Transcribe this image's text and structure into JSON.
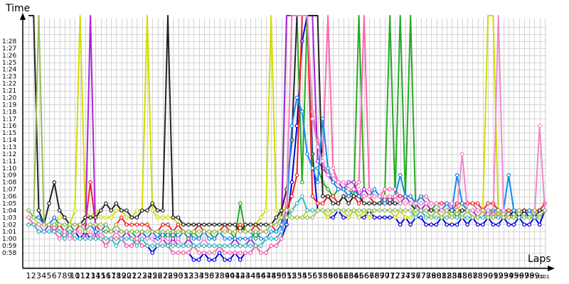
{
  "chart_data": {
    "type": "line",
    "title": "",
    "xlabel": "Laps",
    "ylabel": "Time",
    "x_range": [
      1,
      101
    ],
    "ylim_seconds": [
      56,
      90
    ],
    "grid": true,
    "legend": "none",
    "x_tick_labels": [
      "1",
      "2",
      "3",
      "4",
      "5",
      "6",
      "7",
      "8",
      "9",
      "10",
      "11",
      "12",
      "13",
      "14",
      "15",
      "16",
      "17",
      "18",
      "19",
      "20",
      "21",
      "22",
      "23",
      "24",
      "25",
      "26",
      "27",
      "28",
      "29",
      "30",
      "31",
      "32",
      "33",
      "34",
      "35",
      "36",
      "37",
      "38",
      "39",
      "40",
      "41",
      "42",
      "43",
      "44",
      "45",
      "46",
      "47",
      "48",
      "49",
      "50",
      "51",
      "52",
      "53",
      "54",
      "55",
      "56",
      "57",
      "58",
      "59",
      "60",
      "61",
      "62",
      "63",
      "64",
      "65",
      "66",
      "67",
      "68",
      "69",
      "70",
      "71",
      "72",
      "73",
      "74",
      "75",
      "76",
      "77",
      "78",
      "79",
      "80",
      "81",
      "82",
      "83",
      "84",
      "85",
      "86",
      "87",
      "88",
      "89",
      "90",
      "91",
      "92",
      "93",
      "94",
      "95",
      "96",
      "97",
      "98",
      "99",
      "100",
      "101"
    ],
    "y_tick_labels": [
      "0:58",
      "0:59",
      "1:00",
      "1:01",
      "1:02",
      "1:03",
      "1:04",
      "1:05",
      "1:06",
      "1:07",
      "1:08",
      "1:09",
      "1:10",
      "1:11",
      "1:12",
      "1:13",
      "1:14",
      "1:15",
      "1:16",
      "1:17",
      "1:18",
      "1:19",
      "1:20",
      "1:21",
      "1:22",
      "1:23",
      "1:24",
      "1:25",
      "1:26",
      "1:27",
      "1:28"
    ],
    "series": [
      {
        "color": "#0000dd",
        "y": [
          63,
          62,
          62,
          61,
          61,
          62,
          61,
          60,
          61,
          61,
          60,
          61,
          60,
          60,
          60,
          59,
          60,
          60,
          60,
          59,
          59,
          60,
          59,
          59,
          58,
          59,
          59,
          59,
          58,
          58,
          58,
          58,
          57,
          57,
          58,
          57,
          57,
          58,
          57,
          57,
          58,
          57,
          58,
          58,
          59,
          58,
          58,
          59,
          59,
          60,
          62,
          68,
          76,
          88,
          92,
          72,
          64,
          64,
          63,
          63,
          64,
          63,
          63,
          64,
          63,
          63,
          64,
          63,
          63,
          63,
          63,
          63,
          62,
          63,
          62,
          63,
          63,
          62,
          62,
          62,
          63,
          62,
          62,
          62,
          63,
          62,
          63,
          62,
          62,
          63,
          62,
          62,
          63,
          62,
          62,
          63,
          62,
          62,
          63,
          62,
          64
        ]
      },
      {
        "color": "#d0dd00",
        "y": [
          63,
          63,
          62,
          62,
          62,
          62,
          63,
          63,
          62,
          64,
          95,
          64,
          63,
          64,
          63,
          63,
          63,
          64,
          64,
          63,
          63,
          64,
          64,
          95,
          64,
          63,
          63,
          63,
          63,
          62,
          62,
          62,
          62,
          62,
          62,
          62,
          62,
          62,
          62,
          62,
          62,
          62,
          62,
          62,
          62,
          63,
          64,
          95,
          64,
          63,
          65,
          63,
          63,
          63,
          64,
          64,
          64,
          64,
          63,
          64,
          64,
          64,
          63,
          64,
          63,
          64,
          63,
          64,
          64,
          64,
          64,
          63,
          64,
          63,
          63,
          64,
          64,
          64,
          63,
          64,
          63,
          63,
          64,
          64,
          65,
          64,
          64,
          63,
          64,
          95,
          95,
          63,
          64,
          64,
          63,
          63,
          63,
          63,
          63,
          63,
          64
        ]
      },
      {
        "color": "#22aa22",
        "y": [
          64,
          63,
          63,
          62,
          62,
          62,
          62,
          61,
          62,
          61,
          62,
          61,
          62,
          61,
          61,
          61,
          61,
          61,
          61,
          61,
          61,
          60,
          61,
          60,
          61,
          61,
          60,
          61,
          60,
          61,
          61,
          60,
          61,
          60,
          61,
          61,
          60,
          61,
          61,
          61,
          60,
          65,
          61,
          61,
          60,
          61,
          61,
          62,
          62,
          63,
          95,
          95,
          95,
          68,
          95,
          70,
          70,
          68,
          67,
          66,
          67,
          67,
          67,
          66,
          95,
          67,
          66,
          65,
          65,
          66,
          95,
          66,
          95,
          66,
          95,
          64,
          64,
          64,
          64,
          65,
          64,
          64,
          64,
          63,
          64,
          64,
          63,
          63,
          64,
          63,
          64,
          63,
          63,
          64,
          63,
          63,
          64,
          63,
          63,
          64,
          64
        ]
      },
      {
        "color": "#ff66aa",
        "y": [
          62,
          62,
          61,
          61,
          61,
          61,
          60,
          61,
          60,
          60,
          60,
          60,
          60,
          61,
          60,
          59,
          60,
          60,
          60,
          59,
          59,
          60,
          59,
          59,
          59,
          59,
          59,
          59,
          58,
          58,
          58,
          58,
          59,
          58,
          58,
          58,
          58,
          59,
          58,
          58,
          58,
          58,
          58,
          58,
          59,
          58,
          58,
          59,
          59,
          60,
          65,
          95,
          95,
          95,
          95,
          78,
          74,
          72,
          95,
          70,
          68,
          68,
          67,
          67,
          68,
          95,
          67,
          66,
          66,
          67,
          67,
          67,
          66,
          66,
          66,
          65,
          66,
          66,
          65,
          65,
          65,
          65,
          65,
          65,
          65,
          65,
          65,
          64,
          64,
          64,
          64,
          63,
          64,
          64,
          64,
          63,
          63,
          64,
          63,
          63,
          64
        ]
      },
      {
        "color": "#ee2222",
        "y": [
          63,
          62,
          62,
          61,
          61,
          61,
          62,
          61,
          61,
          61,
          62,
          62,
          68,
          62,
          61,
          62,
          61,
          62,
          63,
          62,
          62,
          62,
          62,
          62,
          61,
          61,
          62,
          62,
          61,
          62,
          61,
          61,
          61,
          62,
          61,
          61,
          61,
          61,
          62,
          61,
          61,
          62,
          61,
          61,
          62,
          61,
          61,
          62,
          61,
          62,
          64,
          66,
          69,
          95,
          95,
          66,
          65,
          65,
          66,
          66,
          65,
          66,
          66,
          66,
          65,
          66,
          66,
          65,
          65,
          66,
          65,
          66,
          66,
          66,
          66,
          65,
          65,
          65,
          65,
          65,
          65,
          65,
          64,
          65,
          65,
          65,
          65,
          65,
          64,
          65,
          65,
          64,
          64,
          64,
          64,
          64,
          64,
          64,
          64,
          64,
          65
        ]
      },
      {
        "color": "#aa22dd",
        "y": [
          62,
          62,
          61,
          61,
          62,
          61,
          61,
          61,
          61,
          61,
          61,
          60,
          95,
          60,
          61,
          60,
          60,
          61,
          60,
          61,
          60,
          60,
          61,
          60,
          60,
          60,
          60,
          59,
          60,
          59,
          59,
          60,
          59,
          59,
          59,
          59,
          59,
          59,
          59,
          59,
          60,
          59,
          59,
          60,
          59,
          59,
          60,
          60,
          60,
          61,
          95,
          95,
          95,
          95,
          95,
          95,
          71,
          70,
          69,
          68,
          68,
          67,
          68,
          68,
          66,
          67,
          66,
          66,
          66,
          65,
          66,
          65,
          65,
          66,
          65,
          65,
          64,
          65,
          64,
          64,
          64,
          64,
          64,
          64,
          64,
          64,
          64,
          63,
          63,
          64,
          63,
          63,
          63,
          63,
          63,
          63,
          63,
          63,
          63,
          63,
          64
        ]
      },
      {
        "color": "#222222",
        "y": [
          95,
          95,
          64,
          62,
          65,
          68,
          64,
          63,
          62,
          62,
          62,
          63,
          63,
          63,
          64,
          65,
          64,
          65,
          64,
          64,
          63,
          63,
          64,
          64,
          65,
          64,
          64,
          95,
          63,
          63,
          62,
          62,
          62,
          62,
          62,
          62,
          62,
          62,
          62,
          62,
          62,
          61,
          62,
          62,
          62,
          62,
          62,
          62,
          63,
          64,
          67,
          74,
          95,
          95,
          95,
          95,
          95,
          66,
          66,
          65,
          65,
          66,
          65,
          66,
          66,
          65,
          65,
          65,
          65,
          65,
          65,
          65,
          65,
          65,
          65,
          64,
          64,
          64,
          64,
          64,
          64,
          64,
          64,
          64,
          64,
          64,
          64,
          64,
          64,
          64,
          64,
          64,
          64,
          63,
          64,
          63,
          64,
          63,
          63,
          64,
          64
        ]
      },
      {
        "color": "#1188ee",
        "y": [
          64,
          63,
          63,
          62,
          62,
          63,
          62,
          62,
          62,
          62,
          62,
          61,
          62,
          61,
          61,
          62,
          61,
          61,
          61,
          61,
          61,
          61,
          61,
          60,
          61,
          60,
          61,
          60,
          61,
          60,
          61,
          61,
          60,
          60,
          61,
          60,
          60,
          61,
          60,
          60,
          60,
          60,
          60,
          60,
          61,
          60,
          60,
          61,
          61,
          62,
          64,
          76,
          80,
          78,
          72,
          70,
          68,
          77,
          70,
          68,
          67,
          67,
          66,
          67,
          66,
          66,
          66,
          67,
          66,
          65,
          66,
          66,
          69,
          66,
          66,
          65,
          66,
          65,
          65,
          65,
          64,
          65,
          64,
          69,
          65,
          64,
          64,
          64,
          64,
          64,
          64,
          64,
          64,
          69,
          64,
          64,
          63,
          64,
          63,
          63,
          64
        ]
      },
      {
        "color": "#ee88cc",
        "y": [
          63,
          62,
          62,
          61,
          61,
          62,
          61,
          61,
          60,
          61,
          61,
          60,
          61,
          60,
          61,
          60,
          60,
          61,
          60,
          60,
          60,
          60,
          60,
          60,
          60,
          59,
          60,
          60,
          59,
          60,
          59,
          59,
          59,
          59,
          60,
          59,
          59,
          59,
          59,
          59,
          59,
          59,
          59,
          59,
          59,
          59,
          60,
          60,
          60,
          61,
          64,
          95,
          95,
          95,
          95,
          77,
          73,
          71,
          69,
          69,
          68,
          68,
          67,
          67,
          67,
          66,
          66,
          66,
          66,
          66,
          66,
          66,
          65,
          65,
          65,
          65,
          65,
          65,
          65,
          65,
          64,
          64,
          65,
          64,
          72,
          64,
          64,
          64,
          64,
          64,
          63,
          95,
          64,
          63,
          63,
          63,
          63,
          63,
          63,
          76,
          64
        ]
      },
      {
        "color": "#33bbbb",
        "y": [
          62,
          62,
          61,
          61,
          61,
          61,
          61,
          60,
          61,
          60,
          60,
          60,
          60,
          60,
          60,
          60,
          60,
          59,
          60,
          60,
          60,
          59,
          60,
          59,
          59,
          59,
          59,
          59,
          59,
          59,
          59,
          59,
          59,
          59,
          59,
          59,
          59,
          59,
          59,
          59,
          59,
          59,
          59,
          59,
          59,
          59,
          60,
          60,
          60,
          61,
          63,
          64,
          65,
          66,
          64,
          64,
          64,
          64,
          64,
          64,
          64,
          64,
          64,
          64,
          64,
          64,
          64,
          64,
          64,
          64,
          64,
          64,
          64,
          64,
          64,
          63,
          64,
          63,
          63,
          63,
          63,
          63,
          63,
          63,
          63,
          63,
          63,
          63,
          63,
          63,
          63,
          63,
          63,
          63,
          63,
          63,
          63,
          63,
          63,
          63,
          64
        ]
      },
      {
        "color": "#99bb55",
        "y": [
          64,
          63,
          95,
          62,
          62,
          62,
          62,
          62,
          62,
          62,
          62,
          61,
          62,
          62,
          62,
          62,
          61,
          62,
          61,
          61,
          61,
          61,
          61,
          61,
          61,
          61,
          61,
          61,
          61,
          61,
          61,
          61,
          61,
          61,
          61,
          61,
          61,
          61,
          61,
          61,
          61,
          61,
          61,
          61,
          61,
          61,
          61,
          62,
          62,
          63,
          63,
          63,
          63,
          63,
          63,
          63,
          64,
          64,
          64,
          64,
          64,
          64,
          64,
          64,
          64,
          64,
          64,
          64,
          64,
          64,
          64,
          64,
          64,
          64,
          64,
          64,
          64,
          64,
          63,
          64,
          63,
          64,
          63,
          64,
          63,
          64,
          63,
          63,
          64,
          63,
          63,
          64,
          63,
          63,
          63,
          64,
          63,
          63,
          64,
          63,
          64
        ]
      }
    ]
  }
}
